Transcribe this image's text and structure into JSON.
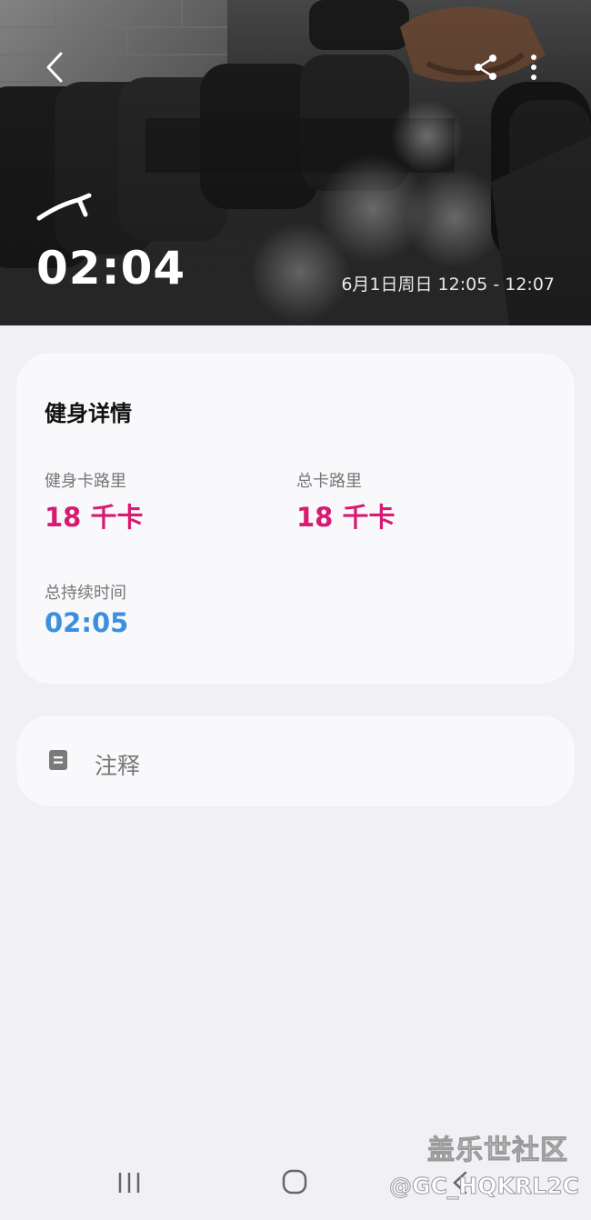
{
  "header": {
    "duration": "02:04",
    "date_range": "6月1日周日 12:05 - 12:07"
  },
  "icons": {
    "back": "chevron-left-icon",
    "share": "share-icon",
    "more": "more-vertical-icon",
    "activity": "weight-training-icon",
    "notes": "note-icon"
  },
  "details": {
    "title": "健身详情",
    "workout_calories": {
      "label": "健身卡路里",
      "value": "18 千卡"
    },
    "total_calories": {
      "label": "总卡路里",
      "value": "18 千卡"
    },
    "total_duration": {
      "label": "总持续时间",
      "value": "02:05"
    }
  },
  "notes": {
    "label": "注释"
  },
  "navbar": {
    "recent": "recent-apps-icon",
    "home": "home-icon",
    "back": "back-icon"
  },
  "watermark": {
    "line1": "盖乐世社区",
    "line2": "@GC_HQKRL2C"
  },
  "colors": {
    "calorie": "#d81b72",
    "duration": "#3b8fde",
    "background": "#f1f0f5",
    "card": "#f9f9fc"
  }
}
